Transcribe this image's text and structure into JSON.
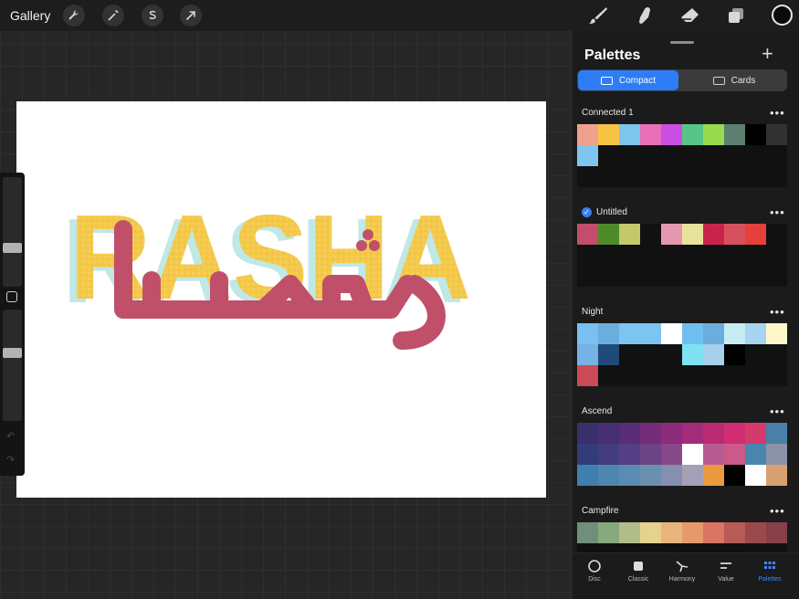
{
  "topbar": {
    "gallery_label": "Gallery",
    "left_tools": [
      "wrench-icon",
      "magic-wand-icon",
      "selection-icon",
      "transform-arrow-icon"
    ],
    "right_tools": [
      "brush-icon",
      "smudge-icon",
      "eraser-icon",
      "layers-icon"
    ],
    "current_color": "#0b0b0b"
  },
  "canvas": {
    "latin_text": "RASHA",
    "arabic_text": "رشا",
    "latin_color": "#f4c94a",
    "shadow_color": "#bfe8e6",
    "arabic_color": "#c0506a",
    "brush_size_level": 0.34,
    "opacity_level": 0.62
  },
  "panel": {
    "title": "Palettes",
    "add_icon": "plus-icon",
    "view_tabs": [
      {
        "label": "Compact",
        "icon": "compact-icon",
        "active": true
      },
      {
        "label": "Cards",
        "icon": "cards-icon",
        "active": false
      }
    ],
    "palettes": [
      {
        "name": "Connected 1",
        "default": false,
        "colors": [
          "#f2a08e",
          "#f7c344",
          "#7ec6ee",
          "#ea6fb8",
          "#c94fe2",
          "#58c487",
          "#98db4e",
          "#5c7f70",
          "#000000",
          "#323232",
          "#7ec6ee"
        ]
      },
      {
        "name": "Untitled",
        "default": true,
        "colors": [
          "#c24d6d",
          "#4f8a2a",
          "#c4c86a",
          "",
          "#e497ae",
          "#e8e29c",
          "#c8244b",
          "#d5525d",
          "#e6403c"
        ]
      },
      {
        "name": "Night",
        "default": false,
        "colors": [
          "#79bff0",
          "#6aaedf",
          "#7cc4f2",
          "#7cc4f2",
          "#ffffff",
          "#6fc0f0",
          "#6aaedf",
          "#c8ecf4",
          "#a7d4f0",
          "#fff6cc",
          "#74b3e4",
          "#1f4a7a",
          "",
          "",
          "",
          "#7ee2f2",
          "#a8d0ea",
          "#000000",
          "",
          "",
          "#cb4a55"
        ]
      },
      {
        "name": "Ascend",
        "default": false,
        "colors": [
          "#37306b",
          "#462f72",
          "#5a2d78",
          "#742c7a",
          "#8c2c7a",
          "#a42a7a",
          "#bb2a75",
          "#d02d72",
          "#d43b6c",
          "#4a7fa8",
          "#313c78",
          "#433d7e",
          "#563f84",
          "#6b4486",
          "#87478b",
          "#ffffff",
          "#b75b93",
          "#c95a8a",
          "#4a85b0",
          "#8c92a8",
          "#3f7fb0",
          "#4f86b0",
          "#5a8bb2",
          "#6a90b0",
          "#868fae",
          "#a6a0b6",
          "#eb9b3e",
          "#000000",
          "#ffffff",
          "#d8a070"
        ]
      },
      {
        "name": "Campfire",
        "default": false,
        "colors": [
          "#6f8f7a",
          "#88a87e",
          "#b0bd8a",
          "#e4d28e",
          "#e9b57c",
          "#e59a6c",
          "#d97462",
          "#b85a55",
          "#9a4a4c",
          "#874048"
        ]
      }
    ]
  },
  "bottom_tabs": [
    {
      "label": "Disc",
      "icon": "disc-icon",
      "active": false
    },
    {
      "label": "Classic",
      "icon": "classic-icon",
      "active": false
    },
    {
      "label": "Harmony",
      "icon": "harmony-icon",
      "active": false
    },
    {
      "label": "Value",
      "icon": "value-icon",
      "active": false
    },
    {
      "label": "Palettes",
      "icon": "palettes-icon",
      "active": true
    }
  ]
}
